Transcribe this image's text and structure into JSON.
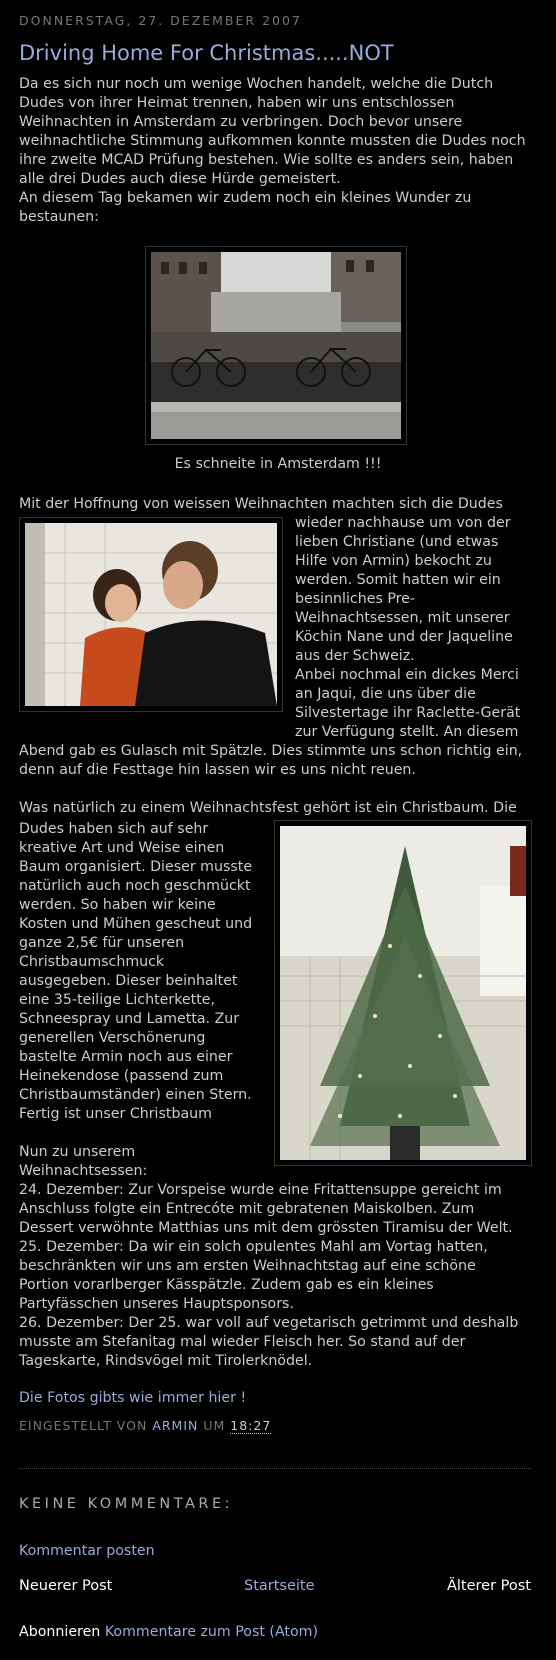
{
  "post": {
    "date_header": "DONNERSTAG, 27. DEZEMBER 2007",
    "title": "Driving Home For Christmas.....NOT",
    "intro_lines": [
      "Da es sich nur noch um wenige Wochen handelt, welche die Dutch",
      "Dudes von ihrer Heimat trennen, haben wir uns entschlossen",
      "Weihnachten in Amsterdam zu verbringen. Doch bevor unsere",
      "weihnachtliche Stimmung aufkommen konnte mussten die Dudes noch",
      "ihre zweite MCAD Prüfung bestehen. Wie sollte es anders sein, haben",
      "alle drei Dudes auch diese Hürde gemeistert.",
      "An diesem Tag bekamen wir zudem noch ein kleines Wunder zu",
      "bestaunen:"
    ],
    "photo1_caption": "Es schneite in Amsterdam !!!",
    "dinner_first_line": "Mit der Hoffnung von weissen Weihnachten machten sich die Dudes",
    "dinner_right_lines": [
      "wieder nachhause um von der",
      "lieben Christiane (und etwas",
      "Hilfe von Armin) bekocht zu",
      "werden. Somit hatten wir ein",
      "besinnliches Pre-",
      "Weihnachtsessen, mit unserer",
      "Köchin Nane und der Jaqueline",
      "aus der Schweiz.",
      "Anbei nochmal ein dickes Merci",
      "an Jaqui, die uns über die",
      "Silvestertage ihr Raclette-Gerät",
      "zur Verfügung stellt. An diesem"
    ],
    "dinner_tail_lines": [
      "Abend gab es Gulasch mit Spätzle. Dies stimmte uns schon richtig ein,",
      "denn auf die Festtage hin lassen wir es uns nicht reuen."
    ],
    "tree_first_line": "Was natürlich zu einem Weihnachtsfest gehört ist ein Christbaum. Die",
    "tree_left_lines": [
      "Dudes haben sich auf sehr",
      "kreative Art und Weise einen",
      "Baum organisiert. Dieser musste",
      "natürlich auch noch geschmückt",
      "werden. So haben wir keine",
      "Kosten und Mühen gescheut und",
      "ganze 2,5€ für unseren",
      "Christbaumschmuck",
      "ausgegeben. Dieser beinhaltet",
      "eine 35-teilige Lichterkette,",
      "Schneespray und Lametta. Zur",
      "generellen Verschönerung",
      "bastelte Armin noch aus einer",
      "Heinekendose (passend zum",
      "Christbaumständer) einen Stern.",
      "Fertig ist unser Christbaum",
      "",
      "Nun zu unserem",
      "Weihnachtsessen:"
    ],
    "menu_lines": [
      "24. Dezember: Zur Vorspeise wurde eine Fritattensuppe gereicht im",
      "Anschluss folgte ein Entrecóte mit gebratenen Maiskolben. Zum",
      "Dessert verwöhnte Matthias uns mit dem grössten Tiramisu der Welt.",
      "25. Dezember: Da wir ein solch opulentes Mahl am Vortag hatten,",
      "beschränkten wir uns am ersten Weihnachtstag auf eine schöne",
      "Portion vorarlberger Kässpätzle. Zudem gab es ein kleines",
      "Partyfässchen unseres Hauptsponsors.",
      "26. Dezember: Der 25. war voll auf vegetarisch getrimmt und deshalb",
      "musste am Stefanitag mal wieder Fleisch her. So stand auf der",
      "Tageskarte, Rindsvögel mit Tirolerknödel."
    ],
    "photos_link": "Die Fotos gibts wie immer hier !",
    "posted_by_prefix": "EINGESTELLT VON",
    "author": "ARMIN",
    "at_label": "UM",
    "time": "18:27"
  },
  "comments": {
    "heading": "KEINE KOMMENTARE:",
    "post_comment": "Kommentar posten"
  },
  "nav": {
    "newer": "Neuerer Post",
    "home": "Startseite",
    "older": "Älterer Post"
  },
  "subscribe": {
    "prefix": "Abonnieren",
    "link": "Kommentare zum Post (Atom)"
  },
  "colors": {
    "background": "#000000",
    "text": "#cccccc",
    "link": "#99aadd",
    "muted": "#777777"
  }
}
